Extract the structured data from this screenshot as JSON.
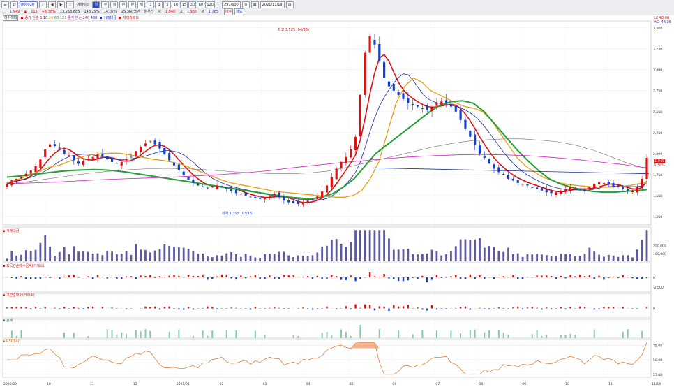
{
  "toolbar": {
    "code_value": "060920",
    "stock_name": "이아이피",
    "btn_daily": "일",
    "btn_weekly": "주",
    "btn_monthly": "월",
    "btn_year": "년",
    "btn_min": "분",
    "btn_tick": "틱",
    "min_options": [
      "1",
      "3",
      "5",
      "10",
      "15",
      "30",
      "60",
      "120"
    ],
    "period_count": "297",
    "period_total": "600",
    "date": "2021/11/19",
    "price": "1,949",
    "change": "115",
    "change_pct": "+6.38%",
    "volume": "13,253,685",
    "vol_ratio": "148.29%",
    "turnover": "14.07%",
    "amount": "25,360백만",
    "pre_mkt": "원우선",
    "open_label": "시",
    "open": "1,840",
    "high_label": "고",
    "high": "1,985",
    "low_label": "저",
    "low": "1,785",
    "buy_btn": "매수",
    "sell_btn": "매도"
  },
  "panels": {
    "price": {
      "head_name": "이아이피",
      "head_items": [
        "종가 단순 5",
        "10",
        "20",
        "60",
        "120",
        "종가 단순 240",
        "480"
      ],
      "head_extra": [
        "거래대금",
        "자이라배드"
      ],
      "annot_high": "최고 3,525 (04/26)",
      "annot_low": "최저 1,395 (03/15)",
      "right_top_1": "LC 48.00",
      "right_top_2": "HC -44.36",
      "badge_price": "1,949",
      "badge_pct": "6.38%"
    },
    "volume": {
      "head": "거래대금"
    },
    "foreign": {
      "head": "외국인순매수금액(거래소)"
    },
    "inst": {
      "head": "기관순매수(거래소)"
    },
    "obv": {
      "head": "관계"
    },
    "rsi": {
      "head": "RSI(14)"
    }
  },
  "colors": {
    "up": "#e01010",
    "down": "#1040d0",
    "ma5": "#e01010",
    "ma10": "#1a2aa8",
    "ma20": "#e8a010",
    "ma60": "#22a035",
    "ma120": "#707070",
    "ma240": "#d020c0"
  },
  "chart_data": {
    "type": "candlestick",
    "x_ticks": [
      "2020/09",
      "10",
      "11",
      "12",
      "2021/01",
      "02",
      "03",
      "04",
      "05",
      "06",
      "07",
      "08",
      "09",
      "10",
      "11",
      "11/19"
    ],
    "y_ticks": [
      1250,
      1500,
      1750,
      2000,
      2250,
      2500,
      2750,
      3000,
      3250,
      3500
    ],
    "ylim": [
      1150,
      3580
    ],
    "series_close": [
      1640,
      1680,
      1700,
      1720,
      1760,
      1800,
      1850,
      1930,
      2050,
      2110,
      2090,
      2060,
      2000,
      1980,
      1920,
      1880,
      1910,
      1940,
      1960,
      1990,
      1970,
      1930,
      1900,
      1880,
      1900,
      1940,
      1960,
      2030,
      2080,
      2120,
      2150,
      2110,
      2060,
      1990,
      1920,
      1860,
      1800,
      1740,
      1690,
      1650,
      1620,
      1600,
      1590,
      1600,
      1620,
      1610,
      1580,
      1550,
      1530,
      1520,
      1500,
      1480,
      1470,
      1460,
      1480,
      1500,
      1520,
      1480,
      1440,
      1420,
      1410,
      1400,
      1420,
      1440,
      1460,
      1490,
      1550,
      1620,
      1720,
      1820,
      1900,
      1960,
      2050,
      2200,
      2700,
      3200,
      3400,
      3300,
      3100,
      2900,
      2800,
      2750,
      2700,
      2650,
      2600,
      2580,
      2560,
      2540,
      2520,
      2560,
      2600,
      2620,
      2600,
      2560,
      2500,
      2400,
      2300,
      2200,
      2100,
      2000,
      1950,
      1880,
      1820,
      1780,
      1750,
      1700,
      1680,
      1650,
      1640,
      1620,
      1600,
      1580,
      1560,
      1540,
      1530,
      1540,
      1560,
      1580,
      1600,
      1590,
      1570,
      1550,
      1600,
      1640,
      1660,
      1650,
      1630,
      1610,
      1600,
      1580,
      1560,
      1550,
      1600,
      1700,
      1949
    ],
    "ma_series": [
      {
        "name": "20",
        "values": [
          1650,
          1680,
          1720,
          1760,
          1800,
          1840,
          1860,
          1900,
          1940,
          1970,
          1990,
          2000,
          2005,
          2005,
          1990,
          1970,
          1950,
          1930,
          1920,
          1900,
          1880,
          1840,
          1800,
          1760,
          1720,
          1680,
          1650,
          1630,
          1610,
          1590,
          1570,
          1550,
          1540,
          1530,
          1520,
          1510,
          1500,
          1490,
          1480,
          1480,
          1500,
          1560,
          1700,
          1900,
          2250,
          2600,
          2800,
          2900,
          2850,
          2750,
          2700,
          2650,
          2600,
          2560,
          2540,
          2500,
          2400,
          2250,
          2100,
          1950,
          1850,
          1780,
          1720,
          1680,
          1650,
          1630,
          1620,
          1610,
          1600,
          1600,
          1600,
          1610,
          1620,
          1640,
          1660
        ]
      },
      {
        "name": "60",
        "values": [
          1720,
          1730,
          1745,
          1760,
          1775,
          1790,
          1800,
          1805,
          1810,
          1805,
          1795,
          1780,
          1760,
          1740,
          1720,
          1700,
          1680,
          1660,
          1640,
          1620,
          1600,
          1580,
          1560,
          1540,
          1520,
          1500,
          1480,
          1470,
          1460,
          1480,
          1520,
          1600,
          1700,
          1850,
          2000,
          2100,
          2200,
          2300,
          2400,
          2500,
          2580,
          2620,
          2630,
          2600,
          2500,
          2350,
          2200,
          2050,
          1920,
          1800,
          1700,
          1640,
          1600,
          1570,
          1550,
          1540,
          1540,
          1550,
          1560,
          1570
        ]
      },
      {
        "name": "120",
        "values": [
          1640,
          1660,
          1690,
          1720,
          1750,
          1775,
          1795,
          1810,
          1820,
          1825,
          1820,
          1810,
          1795,
          1780,
          1770,
          1760,
          1760,
          1770,
          1790,
          1830,
          1880,
          1930,
          1980,
          2030,
          2080,
          2120,
          2150,
          2165,
          2175,
          2175,
          2160,
          2140,
          2100,
          2040,
          1960,
          1880,
          1820
        ]
      },
      {
        "name": "240",
        "values": [
          1640,
          1650,
          1660,
          1675,
          1690,
          1700,
          1710,
          1720,
          1735,
          1750,
          1770,
          1795,
          1830,
          1860,
          1890,
          1915,
          1940,
          1960,
          1975,
          1985,
          1990,
          1985,
          1975,
          1955,
          1930,
          1900,
          1870,
          1830
        ]
      }
    ],
    "volume": {
      "ylim": [
        0,
        420000
      ],
      "y_ticks": [
        100000,
        200000
      ]
    },
    "foreign": {
      "y_ticks": [
        0,
        -2500
      ]
    },
    "rsi": {
      "y_ticks": [
        25,
        50,
        75
      ],
      "ylim": [
        20,
        85
      ]
    }
  }
}
